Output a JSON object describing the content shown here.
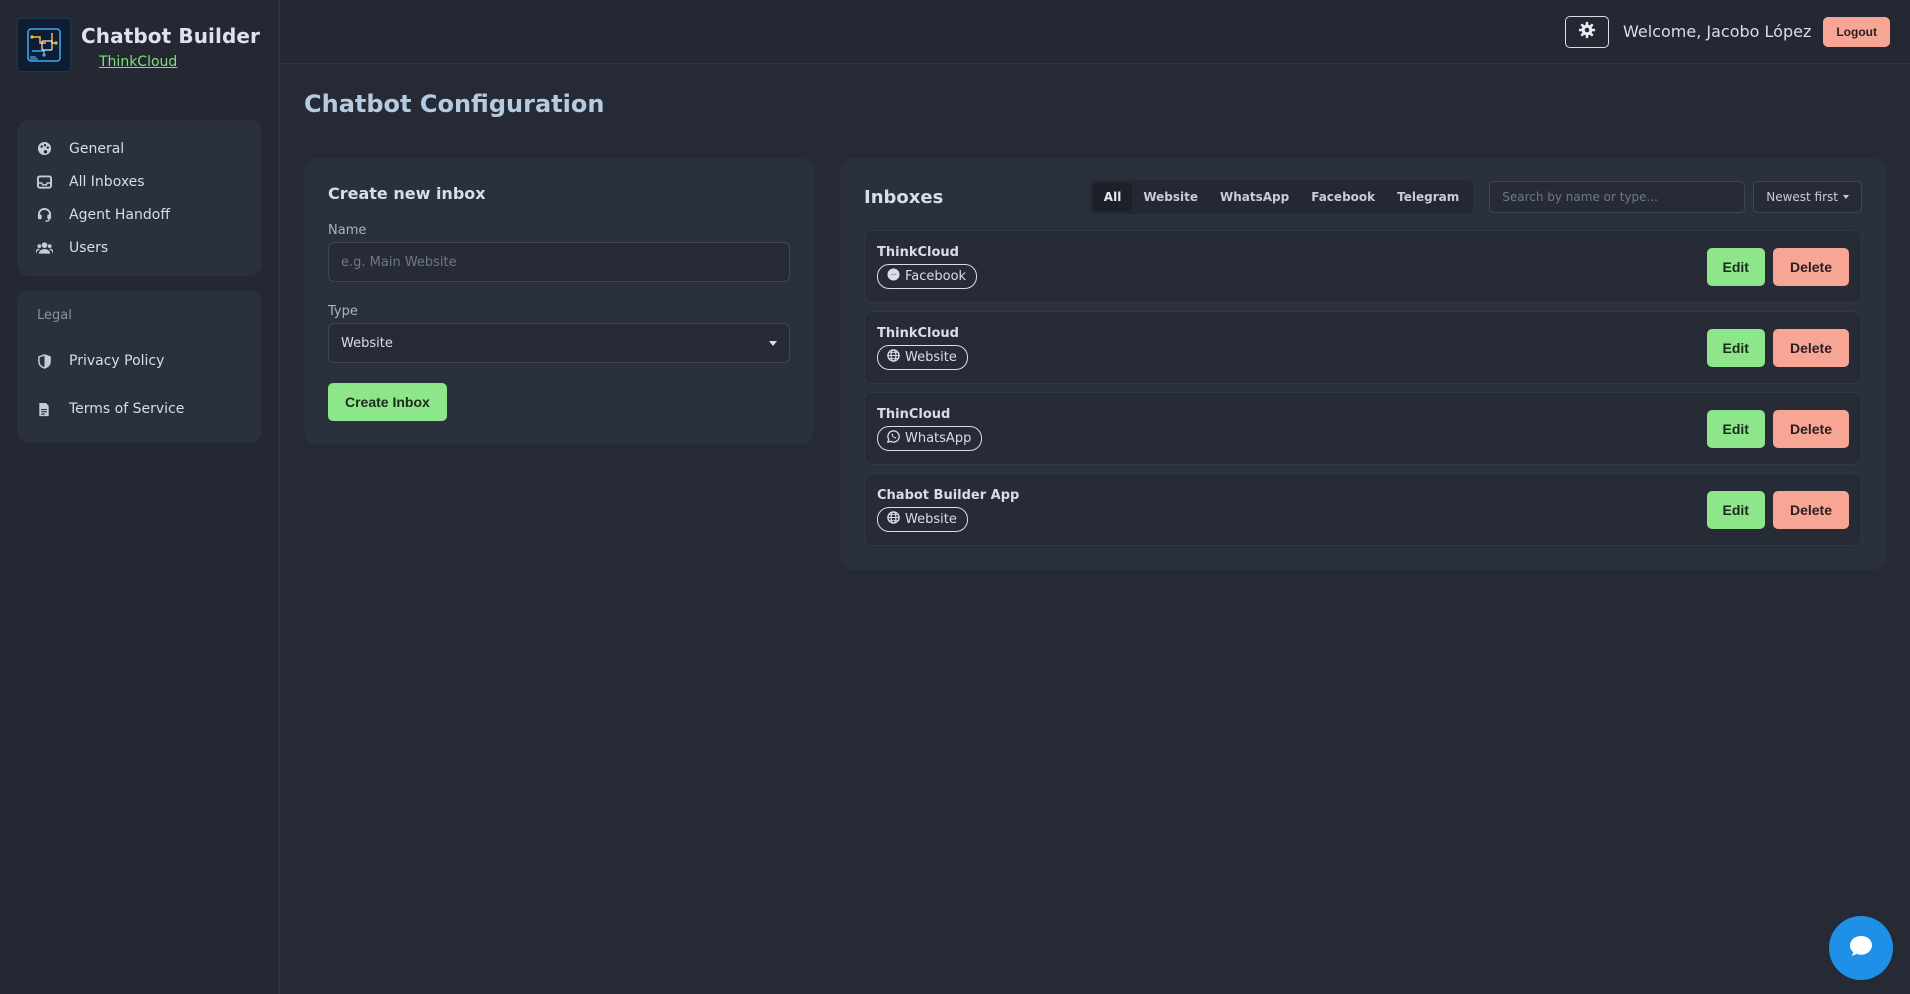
{
  "brand": {
    "title": "Chatbot Builder",
    "subtitle": "ThinkCloud"
  },
  "nav": {
    "items": [
      {
        "label": "General",
        "icon": "palette-icon"
      },
      {
        "label": "All Inboxes",
        "icon": "inbox-icon"
      },
      {
        "label": "Agent Handoff",
        "icon": "headset-icon"
      },
      {
        "label": "Users",
        "icon": "users-icon"
      }
    ],
    "legal_title": "Legal",
    "legal_items": [
      {
        "label": "Privacy Policy",
        "icon": "shield-icon"
      },
      {
        "label": "Terms of Service",
        "icon": "document-icon"
      }
    ]
  },
  "header": {
    "welcome": "Welcome, Jacobo López",
    "logout_label": "Logout",
    "theme_icon": "gear-icon"
  },
  "page": {
    "title": "Chatbot Configuration"
  },
  "create_inbox": {
    "title": "Create new inbox",
    "name_label": "Name",
    "name_placeholder": "e.g. Main Website",
    "type_label": "Type",
    "type_value": "Website",
    "submit_label": "Create Inbox"
  },
  "inboxes": {
    "title": "Inboxes",
    "filters": [
      "All",
      "Website",
      "WhatsApp",
      "Facebook",
      "Telegram"
    ],
    "active_filter": "All",
    "search_placeholder": "Search by name or type...",
    "sort_label": "Newest first",
    "edit_label": "Edit",
    "delete_label": "Delete",
    "items": [
      {
        "name": "ThinkCloud",
        "type": "Facebook",
        "icon": "messenger-icon"
      },
      {
        "name": "ThinkCloud",
        "type": "Website",
        "icon": "globe-icon"
      },
      {
        "name": "ThinCloud",
        "type": "WhatsApp",
        "icon": "whatsapp-icon"
      },
      {
        "name": "Chabot Builder App",
        "type": "Website",
        "icon": "globe-icon"
      }
    ]
  },
  "colors": {
    "background": "#252a34",
    "card": "#2a303c",
    "accent_green": "#8ee68a",
    "accent_salmon": "#f7a595",
    "title_blue": "#b6cbe0",
    "fab_blue": "#1e90e8"
  }
}
